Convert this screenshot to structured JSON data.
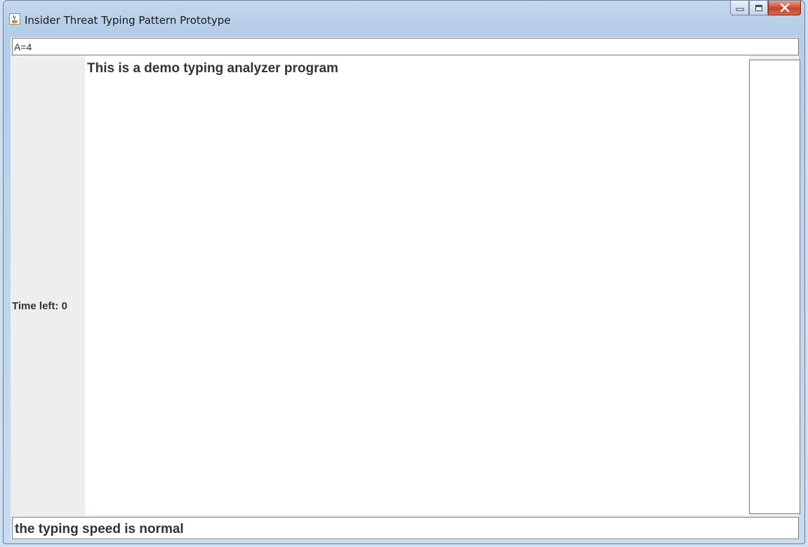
{
  "window": {
    "title": "Insider Threat Typing Pattern Prototype",
    "app_icon": "java-cup-icon",
    "controls": {
      "minimize_icon": "minimize-icon",
      "maximize_icon": "maximize-icon",
      "close_icon": "close-icon"
    }
  },
  "top_field": {
    "value": "A=4"
  },
  "left_panel": {
    "time_label": "Time left: 0"
  },
  "main_area": {
    "heading": "This is a demo typing analyzer program"
  },
  "status_field": {
    "value": "the typing speed is normal"
  },
  "colors": {
    "title_bar": "#b6cde8",
    "panel_background": "#eeeeee",
    "close_button": "#c9452b",
    "text": "#333333"
  }
}
